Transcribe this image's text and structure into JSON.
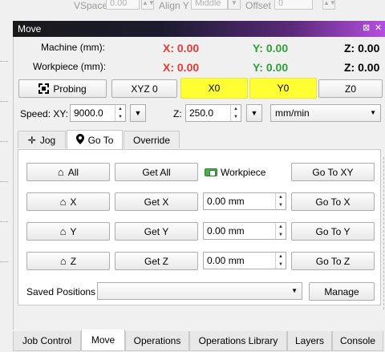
{
  "toolbar": {
    "vspace_label": "VSpace",
    "vspace_value": "0.00",
    "aligny_label": "Align Y",
    "aligny_value": "Middle",
    "offset_label": "Offset",
    "offset_value": "0"
  },
  "window": {
    "title": "Move",
    "float_glyph": "⊠",
    "close_glyph": "✕"
  },
  "position": {
    "machine_label": "Machine (mm):",
    "workpiece_label": "Workpiece (mm):",
    "machine": {
      "x": "X: 0.00",
      "y": "Y: 0.00",
      "z": "Z: 0.00"
    },
    "workpiece": {
      "x": "X: 0.00",
      "y": "Y: 0.00",
      "z": "Z: 0.00"
    }
  },
  "actions": {
    "probing": "Probing",
    "xyz0": "XYZ 0",
    "x0": "X0",
    "y0": "Y0",
    "z0": "Z0"
  },
  "speed": {
    "xy_label": "Speed: XY:",
    "xy_value": "9000.0",
    "z_label": "Z:",
    "z_value": "250.0",
    "unit": "mm/min"
  },
  "tabs": {
    "jog": "Jog",
    "goto": "Go To",
    "override": "Override"
  },
  "goto": {
    "all_label": "All",
    "get_all": "Get All",
    "workpiece_label": "Workpiece",
    "goto_xy": "Go To XY",
    "x_label": "X",
    "y_label": "Y",
    "z_label": "Z",
    "get_x": "Get X",
    "get_y": "Get Y",
    "get_z": "Get Z",
    "x_value": "0.00 mm",
    "y_value": "0.00 mm",
    "z_value": "0.00 mm",
    "goto_x": "Go To X",
    "goto_y": "Go To Y",
    "goto_z": "Go To Z",
    "saved_positions_label": "Saved Positions",
    "saved_positions_value": "",
    "manage": "Manage"
  },
  "bottom_tabs": [
    "Job Control",
    "Move",
    "Operations",
    "Operations Library",
    "Layers",
    "Console"
  ],
  "colors": {
    "x_axis": "#e53935",
    "y_axis": "#2e9e3c",
    "highlight": "#ffff33"
  }
}
